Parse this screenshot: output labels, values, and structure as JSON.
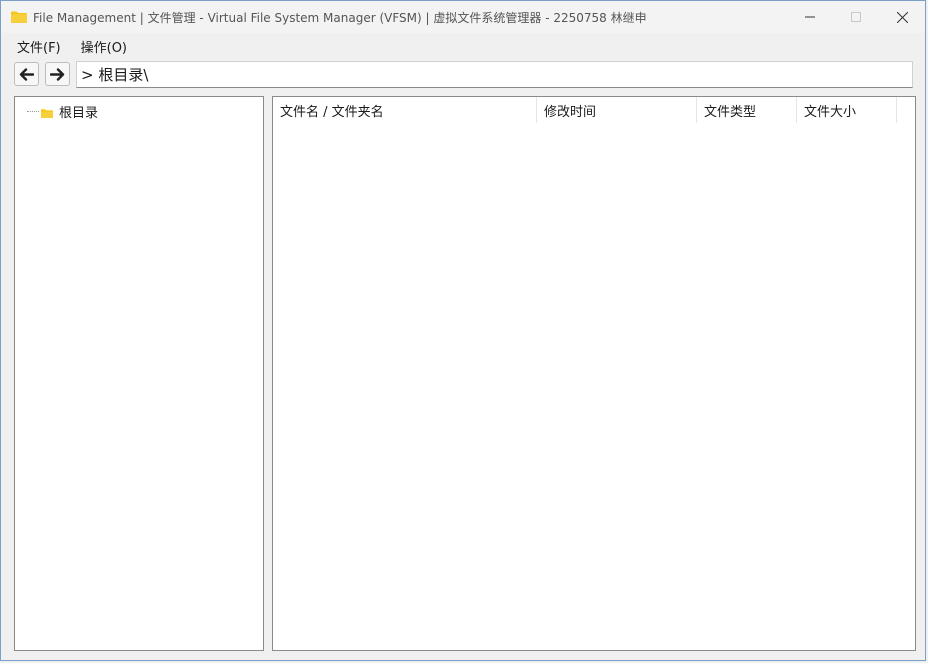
{
  "window": {
    "title": "File Management | 文件管理 - Virtual File System Manager (VFSM) | 虚拟文件系统管理器 - 2250758 林继申",
    "controls": {
      "minimize": "—",
      "maximize": "☐",
      "close": "✕"
    }
  },
  "menubar": {
    "items": [
      {
        "label": "文件(F)"
      },
      {
        "label": "操作(O)"
      }
    ]
  },
  "toolbar": {
    "back_icon": "arrow-left-icon",
    "forward_icon": "arrow-right-icon",
    "address": "> 根目录\\"
  },
  "tree": {
    "items": [
      {
        "label": "根目录",
        "icon": "folder-icon"
      }
    ]
  },
  "list": {
    "columns": [
      {
        "label": "文件名 / 文件夹名"
      },
      {
        "label": "修改时间"
      },
      {
        "label": "文件类型"
      },
      {
        "label": "文件大小"
      }
    ],
    "rows": []
  },
  "colors": {
    "folder": "#f5c518",
    "border": "#8a8a8a",
    "window_border": "#7aa0c8"
  }
}
